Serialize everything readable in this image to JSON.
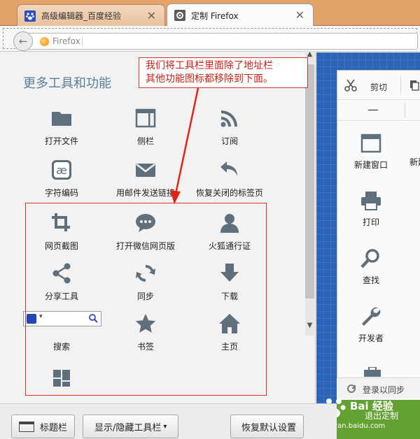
{
  "browser": {
    "tabs": [
      {
        "label": "高级编辑器_百度经验",
        "active": false
      },
      {
        "label": "定制 Firefox",
        "active": true
      }
    ],
    "close_glyph": "✕",
    "url_placeholder": "Firefox",
    "back_glyph": "←"
  },
  "palette": {
    "title": "更多工具和功能",
    "items": [
      {
        "label": "打开文件",
        "icon": "folder-icon"
      },
      {
        "label": "侧栏",
        "icon": "sidebar-icon"
      },
      {
        "label": "订阅",
        "icon": "rss-icon"
      },
      {
        "label": "字符编码",
        "icon": "character-encoding-icon"
      },
      {
        "label": "用邮件发送链接",
        "icon": "email-icon"
      },
      {
        "label": "恢复关闭的标签页",
        "icon": "undo-icon"
      },
      {
        "label": "网页截图",
        "icon": "crop-icon"
      },
      {
        "label": "打开微信网页版",
        "icon": "chat-bubble-icon"
      },
      {
        "label": "火狐通行证",
        "icon": "person-icon"
      },
      {
        "label": "分享工具",
        "icon": "share-icon"
      },
      {
        "label": "同步",
        "icon": "sync-icon"
      },
      {
        "label": "下载",
        "icon": "download-icon"
      },
      {
        "label": "搜索",
        "icon": "search-box-icon"
      },
      {
        "label": "书签",
        "icon": "star-icon"
      },
      {
        "label": "主页",
        "icon": "home-icon"
      },
      {
        "label": "",
        "icon": "tiles-icon"
      }
    ]
  },
  "annotation": {
    "line1": "我们将工具栏里面除了地址栏",
    "line2": "其他功能图标都移除到下面。",
    "color": "#d23a2f"
  },
  "menu_panel": {
    "cut_label": "剪切",
    "zoom_minus": "—",
    "items": [
      {
        "label": "新建窗口",
        "icon": "new-window-icon"
      },
      {
        "label": "打印",
        "icon": "printer-icon"
      },
      {
        "label": "查找",
        "icon": "magnifier-icon"
      },
      {
        "label": "开发者",
        "icon": "wrench-icon"
      }
    ],
    "partial_label": "新建",
    "login_label": "登录以同步"
  },
  "footer": {
    "titlebar_label": "标题栏",
    "toolbars_label": "显示/隐藏工具栏",
    "toolbars_caret": "▾",
    "restore_label": "恢复默认设置"
  },
  "watermark": {
    "brand": "Bai 经验",
    "url": "jingyan.baidu.com",
    "exit": "退出定制"
  },
  "colors": {
    "tabstrip": "#e3a268",
    "title_blue": "#5a7e98",
    "icon_gray": "#5f6f7c",
    "workspace_blue": "#2b63b7",
    "highlight_red": "#d9342b"
  }
}
